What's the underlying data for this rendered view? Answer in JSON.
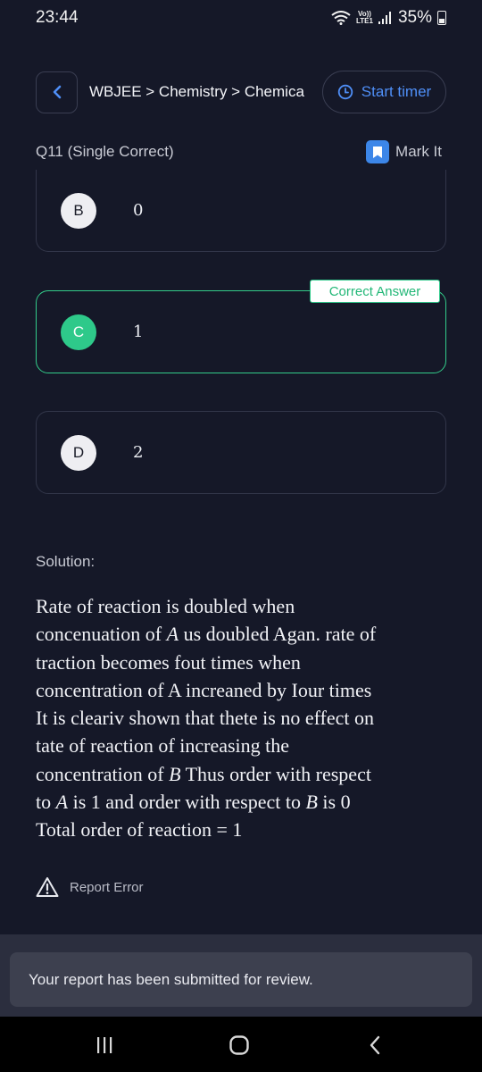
{
  "status_bar": {
    "time": "23:44",
    "volte_line1": "Vo))",
    "volte_line2": "LTE1",
    "battery": "35%",
    "icons": [
      "wifi-icon",
      "volte-icon",
      "signal-icon",
      "battery-icon"
    ]
  },
  "header": {
    "back_icon": "chevron-left-icon",
    "breadcrumb": "WBJEE > Chemistry > Chemica",
    "timer_icon": "clock-icon",
    "timer_label": "Start timer"
  },
  "question": {
    "label": "Q11 (Single Correct)",
    "mark_label": "Mark It",
    "mark_icon": "bookmark-icon"
  },
  "options": [
    {
      "letter": "B",
      "value": "0"
    },
    {
      "letter": "C",
      "value": "1"
    },
    {
      "letter": "D",
      "value": "2"
    }
  ],
  "correct_label": "Correct Answer",
  "solution": {
    "label": "Solution:",
    "lines": [
      {
        "pre": "Rate of reaction is doubled when",
        "math": "",
        "post": ""
      },
      {
        "pre": "concenuation of ",
        "math": "A",
        "post": " us doubled Agan. rate of"
      },
      {
        "pre": "traction becomes fout times when",
        "math": "",
        "post": ""
      },
      {
        "pre": "concentration of A increaned by Iour times",
        "math": "",
        "post": ""
      },
      {
        "pre": "It is cleariv shown that thete is no effect on",
        "math": "",
        "post": ""
      },
      {
        "pre": "tate of reaction of increasing the",
        "math": "",
        "post": ""
      },
      {
        "pre": "concentration of ",
        "math": "B",
        "post": " Thus order with respect"
      },
      {
        "pre": "to ",
        "math": "A",
        "post": " is 1 and order with respect to "
      },
      {
        "pre": "Total order of reaction = 1",
        "math": "",
        "post": ""
      }
    ],
    "line8_math2": "B",
    "line8_tail": " is 0"
  },
  "report": {
    "icon": "warning-icon",
    "label": "Report Error"
  },
  "toast": {
    "message": "Your report has been submitted for review."
  },
  "nav": {
    "icons": [
      "recent-apps-icon",
      "home-icon",
      "back-icon"
    ]
  },
  "colors": {
    "background": "#151828",
    "accent_blue": "#4f8ff7",
    "correct_green": "#2ec98a"
  }
}
